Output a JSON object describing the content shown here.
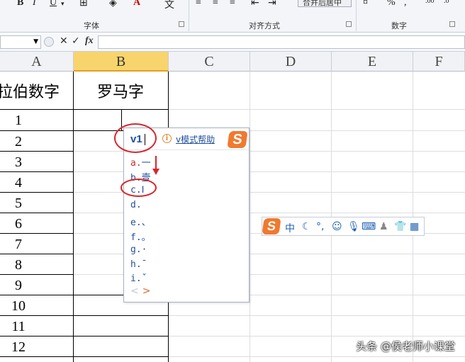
{
  "ribbon": {
    "groups": [
      {
        "label": "字体"
      },
      {
        "label": "对齐方式"
      },
      {
        "label": "数字"
      }
    ],
    "merge_label": "合并后居中",
    "percent": "%",
    "comma": ","
  },
  "formula_bar": {
    "cancel": "✕",
    "enter": "✓",
    "fx": "fx",
    "value": ""
  },
  "columns": [
    "A",
    "B",
    "C",
    "D",
    "E",
    "F"
  ],
  "selected_column": "B",
  "headers": {
    "a": "拉伯数字",
    "b": "罗马字"
  },
  "rows": [
    "1",
    "2",
    "3",
    "4",
    "5",
    "6",
    "7",
    "8",
    "9",
    "10",
    "11",
    "12"
  ],
  "ime": {
    "input": "v1",
    "help_label": "v模式帮助",
    "logo": "S",
    "candidates": [
      {
        "key": "a.",
        "text": "一"
      },
      {
        "key": "b.",
        "text": "壹"
      },
      {
        "key": "c.",
        "text": "Ⅰ"
      },
      {
        "key": "d.",
        "text": ""
      },
      {
        "key": "e.",
        "text": "、"
      },
      {
        "key": "f.",
        "text": "。"
      },
      {
        "key": "g.",
        "text": "·"
      },
      {
        "key": "h.",
        "text": "¯"
      },
      {
        "key": "i.",
        "text": "ˇ"
      }
    ],
    "prev": "<",
    "next": ">"
  },
  "ime_toolbar": {
    "logo": "S",
    "lang": "中",
    "items": [
      "moon-icon",
      "punctuation-icon",
      "emoji-icon",
      "mic-icon",
      "keyboard-icon",
      "user-icon",
      "skin-icon",
      "grid-icon"
    ]
  },
  "watermark": "头条 @侯老师小课堂",
  "colors": {
    "accent_red": "#d8262b",
    "sogou_orange": "#f07a2e",
    "ime_blue": "#1f4fa0",
    "selected_header": "#f8d46c"
  }
}
